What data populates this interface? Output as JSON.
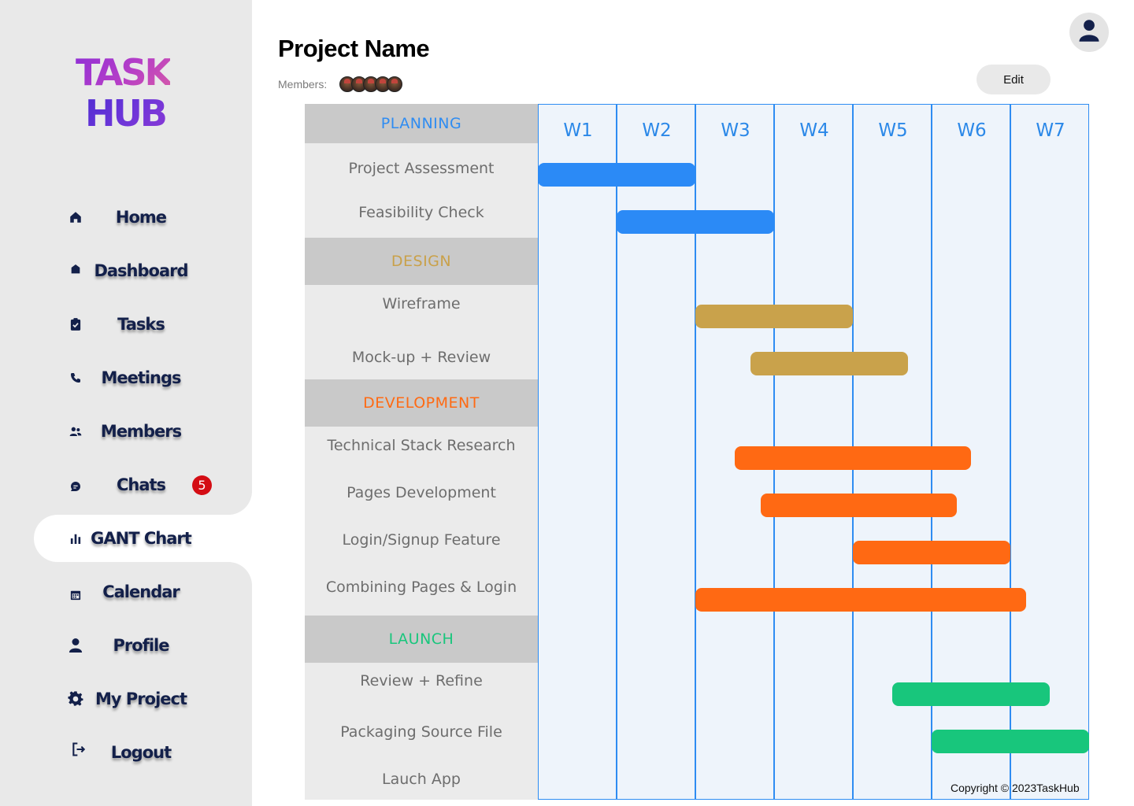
{
  "logo": {
    "line1": "TASK",
    "line2": "HUB"
  },
  "sidebar": {
    "items": [
      {
        "label": "Home",
        "icon": "home-icon"
      },
      {
        "label": "Dashboard",
        "icon": "dashboard-icon"
      },
      {
        "label": "Tasks",
        "icon": "clipboard-check-icon"
      },
      {
        "label": "Meetings",
        "icon": "phone-icon"
      },
      {
        "label": "Members",
        "icon": "users-icon"
      },
      {
        "label": "Chats",
        "icon": "chat-icon",
        "badge": "5"
      },
      {
        "label": "GANT Chart",
        "icon": "bar-chart-icon",
        "active": true
      },
      {
        "label": "Calendar",
        "icon": "calendar-icon"
      },
      {
        "label": "Profile",
        "icon": "user-icon"
      },
      {
        "label": "My Project",
        "icon": "gear-icon"
      },
      {
        "label": "Logout",
        "icon": "logout-icon"
      }
    ]
  },
  "header": {
    "title": "Project Name",
    "members_label": "Members:",
    "edit_label": "Edit",
    "user_icon": "user-circle-icon"
  },
  "gantt": {
    "weeks": [
      "W1",
      "W2",
      "W3",
      "W4",
      "W5",
      "W6",
      "W7"
    ],
    "phases": [
      {
        "name": "PLANNING",
        "color": "#2e8cf2",
        "bar_color": "#2b8af6",
        "tasks": [
          {
            "name": "Project Assessment",
            "start": 0,
            "end": 2
          },
          {
            "name": "Feasibility Check",
            "start": 1,
            "end": 3
          }
        ]
      },
      {
        "name": "DESIGN",
        "color": "#c9a14a",
        "bar_color": "#c9a24b",
        "tasks": [
          {
            "name": "Wireframe",
            "start": 2,
            "end": 4
          },
          {
            "name": "Mock-up + Review",
            "start": 2.7,
            "end": 4.7
          }
        ]
      },
      {
        "name": "DEVELOPMENT",
        "color": "#ff6a13",
        "bar_color": "#ff6913",
        "tasks": [
          {
            "name": "Technical Stack Research",
            "start": 2.5,
            "end": 5.5
          },
          {
            "name": "Pages Development",
            "start": 2.83,
            "end": 5.32
          },
          {
            "name": "Login/Signup Feature",
            "start": 4,
            "end": 6
          },
          {
            "name": "Combining Pages & Login",
            "start": 2,
            "end": 6.2
          }
        ]
      },
      {
        "name": "LAUNCH",
        "color": "#18c67c",
        "bar_color": "#18c67c",
        "tasks": [
          {
            "name": "Review + Refine",
            "start": 4.5,
            "end": 6.5
          },
          {
            "name": "Packaging Source File",
            "start": 5,
            "end": 7
          },
          {
            "name": "Lauch App",
            "start": null,
            "end": null
          }
        ]
      }
    ]
  },
  "footer": {
    "copyright": "Copyright © 2023TaskHub"
  }
}
